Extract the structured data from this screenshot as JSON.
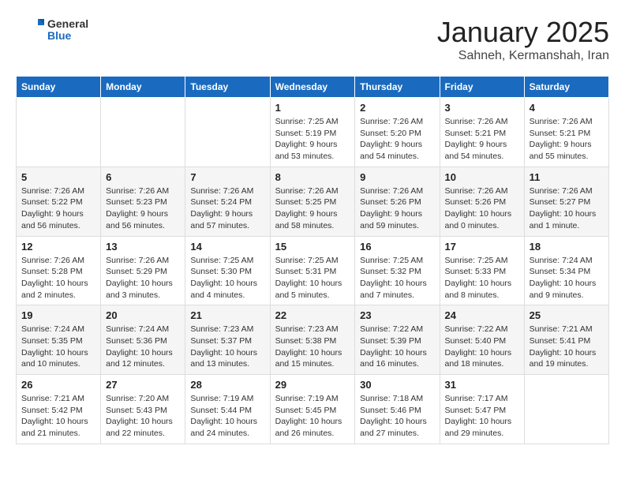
{
  "header": {
    "logo_general": "General",
    "logo_blue": "Blue",
    "month": "January 2025",
    "location": "Sahneh, Kermanshah, Iran"
  },
  "days_of_week": [
    "Sunday",
    "Monday",
    "Tuesday",
    "Wednesday",
    "Thursday",
    "Friday",
    "Saturday"
  ],
  "weeks": [
    [
      {
        "day": "",
        "info": ""
      },
      {
        "day": "",
        "info": ""
      },
      {
        "day": "",
        "info": ""
      },
      {
        "day": "1",
        "info": "Sunrise: 7:25 AM\nSunset: 5:19 PM\nDaylight: 9 hours and 53 minutes."
      },
      {
        "day": "2",
        "info": "Sunrise: 7:26 AM\nSunset: 5:20 PM\nDaylight: 9 hours and 54 minutes."
      },
      {
        "day": "3",
        "info": "Sunrise: 7:26 AM\nSunset: 5:21 PM\nDaylight: 9 hours and 54 minutes."
      },
      {
        "day": "4",
        "info": "Sunrise: 7:26 AM\nSunset: 5:21 PM\nDaylight: 9 hours and 55 minutes."
      }
    ],
    [
      {
        "day": "5",
        "info": "Sunrise: 7:26 AM\nSunset: 5:22 PM\nDaylight: 9 hours and 56 minutes."
      },
      {
        "day": "6",
        "info": "Sunrise: 7:26 AM\nSunset: 5:23 PM\nDaylight: 9 hours and 56 minutes."
      },
      {
        "day": "7",
        "info": "Sunrise: 7:26 AM\nSunset: 5:24 PM\nDaylight: 9 hours and 57 minutes."
      },
      {
        "day": "8",
        "info": "Sunrise: 7:26 AM\nSunset: 5:25 PM\nDaylight: 9 hours and 58 minutes."
      },
      {
        "day": "9",
        "info": "Sunrise: 7:26 AM\nSunset: 5:26 PM\nDaylight: 9 hours and 59 minutes."
      },
      {
        "day": "10",
        "info": "Sunrise: 7:26 AM\nSunset: 5:26 PM\nDaylight: 10 hours and 0 minutes."
      },
      {
        "day": "11",
        "info": "Sunrise: 7:26 AM\nSunset: 5:27 PM\nDaylight: 10 hours and 1 minute."
      }
    ],
    [
      {
        "day": "12",
        "info": "Sunrise: 7:26 AM\nSunset: 5:28 PM\nDaylight: 10 hours and 2 minutes."
      },
      {
        "day": "13",
        "info": "Sunrise: 7:26 AM\nSunset: 5:29 PM\nDaylight: 10 hours and 3 minutes."
      },
      {
        "day": "14",
        "info": "Sunrise: 7:25 AM\nSunset: 5:30 PM\nDaylight: 10 hours and 4 minutes."
      },
      {
        "day": "15",
        "info": "Sunrise: 7:25 AM\nSunset: 5:31 PM\nDaylight: 10 hours and 5 minutes."
      },
      {
        "day": "16",
        "info": "Sunrise: 7:25 AM\nSunset: 5:32 PM\nDaylight: 10 hours and 7 minutes."
      },
      {
        "day": "17",
        "info": "Sunrise: 7:25 AM\nSunset: 5:33 PM\nDaylight: 10 hours and 8 minutes."
      },
      {
        "day": "18",
        "info": "Sunrise: 7:24 AM\nSunset: 5:34 PM\nDaylight: 10 hours and 9 minutes."
      }
    ],
    [
      {
        "day": "19",
        "info": "Sunrise: 7:24 AM\nSunset: 5:35 PM\nDaylight: 10 hours and 10 minutes."
      },
      {
        "day": "20",
        "info": "Sunrise: 7:24 AM\nSunset: 5:36 PM\nDaylight: 10 hours and 12 minutes."
      },
      {
        "day": "21",
        "info": "Sunrise: 7:23 AM\nSunset: 5:37 PM\nDaylight: 10 hours and 13 minutes."
      },
      {
        "day": "22",
        "info": "Sunrise: 7:23 AM\nSunset: 5:38 PM\nDaylight: 10 hours and 15 minutes."
      },
      {
        "day": "23",
        "info": "Sunrise: 7:22 AM\nSunset: 5:39 PM\nDaylight: 10 hours and 16 minutes."
      },
      {
        "day": "24",
        "info": "Sunrise: 7:22 AM\nSunset: 5:40 PM\nDaylight: 10 hours and 18 minutes."
      },
      {
        "day": "25",
        "info": "Sunrise: 7:21 AM\nSunset: 5:41 PM\nDaylight: 10 hours and 19 minutes."
      }
    ],
    [
      {
        "day": "26",
        "info": "Sunrise: 7:21 AM\nSunset: 5:42 PM\nDaylight: 10 hours and 21 minutes."
      },
      {
        "day": "27",
        "info": "Sunrise: 7:20 AM\nSunset: 5:43 PM\nDaylight: 10 hours and 22 minutes."
      },
      {
        "day": "28",
        "info": "Sunrise: 7:19 AM\nSunset: 5:44 PM\nDaylight: 10 hours and 24 minutes."
      },
      {
        "day": "29",
        "info": "Sunrise: 7:19 AM\nSunset: 5:45 PM\nDaylight: 10 hours and 26 minutes."
      },
      {
        "day": "30",
        "info": "Sunrise: 7:18 AM\nSunset: 5:46 PM\nDaylight: 10 hours and 27 minutes."
      },
      {
        "day": "31",
        "info": "Sunrise: 7:17 AM\nSunset: 5:47 PM\nDaylight: 10 hours and 29 minutes."
      },
      {
        "day": "",
        "info": ""
      }
    ]
  ]
}
